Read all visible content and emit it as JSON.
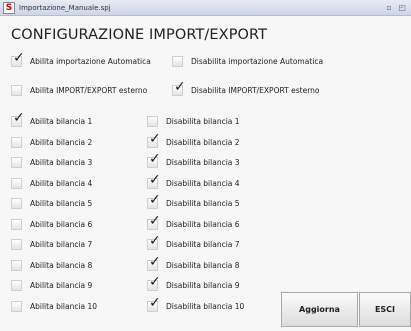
{
  "window": {
    "title": "Importazione_Manuale.spj",
    "controls": "▫ ◰"
  },
  "heading": "CONFIGURAZIONE IMPORT/EXPORT",
  "options": {
    "enable_auto": {
      "label": "Abilita importazione Automatica",
      "checked": true
    },
    "disable_auto": {
      "label": "Disabilita importazione Automatica",
      "checked": false
    },
    "enable_ext": {
      "label": "Abilita IMPORT/EXPORT esterno",
      "checked": false
    },
    "disable_ext": {
      "label": "Disabilita IMPORT/EXPORT esterno",
      "checked": true
    }
  },
  "scales": [
    {
      "enable": "Abilita bilancia 1",
      "enable_checked": true,
      "disable": "Disabilita bilancia 1",
      "disable_checked": false
    },
    {
      "enable": "Abilita bilancia 2",
      "enable_checked": false,
      "disable": "Disabilita bilancia 2",
      "disable_checked": true
    },
    {
      "enable": "Abilita bilancia 3",
      "enable_checked": false,
      "disable": "Disabilita bilancia 3",
      "disable_checked": true
    },
    {
      "enable": "Abilita bilancia 4",
      "enable_checked": false,
      "disable": "Disabilita bilancia 4",
      "disable_checked": true
    },
    {
      "enable": "Abilita bilancia 5",
      "enable_checked": false,
      "disable": "Disabilita bilancia 5",
      "disable_checked": true
    },
    {
      "enable": "Abilita bilancia 6",
      "enable_checked": false,
      "disable": "Disabilita bilancia 6",
      "disable_checked": true
    },
    {
      "enable": "Abilita bilancia 7",
      "enable_checked": false,
      "disable": "Disabilita bilancia 7",
      "disable_checked": true
    },
    {
      "enable": "Abilita bilancia 8",
      "enable_checked": false,
      "disable": "Disabilita bilancia 8",
      "disable_checked": true
    },
    {
      "enable": "Abilita bilancia 9",
      "enable_checked": false,
      "disable": "Disabilita bilancia 9",
      "disable_checked": true
    },
    {
      "enable": "Abilita bilancia 10",
      "enable_checked": false,
      "disable": "Disabilita bilancia 10",
      "disable_checked": true
    }
  ],
  "buttons": {
    "update": "Aggiorna",
    "exit": "ESCI"
  },
  "check_glyph": "✓"
}
